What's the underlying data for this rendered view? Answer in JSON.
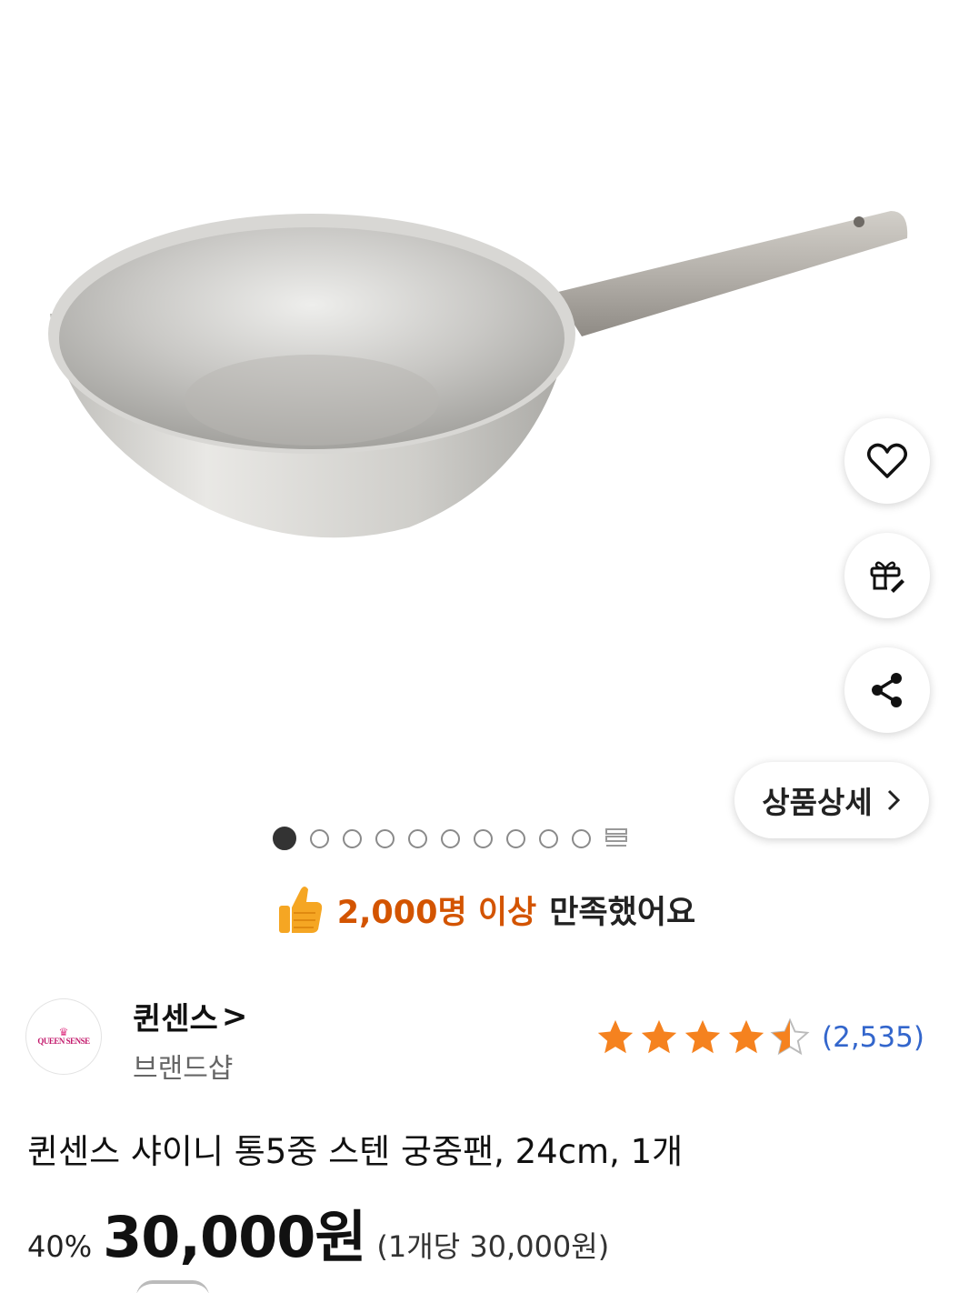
{
  "hero": {
    "image_alt": "stainless wok pan product photo"
  },
  "actions": {
    "wishlist_icon": "heart-icon",
    "gift_icon": "gift-icon",
    "share_icon": "share-icon"
  },
  "detail_button": {
    "label": "상품상세",
    "icon": "chevron-right-icon"
  },
  "carousel": {
    "total_dots": 10,
    "active_index": 0
  },
  "satisfaction": {
    "icon": "thumbs-up-icon",
    "highlight": "2,000명 이상",
    "text": "만족했어요"
  },
  "brand": {
    "logo_text": "QUEEN SENSE",
    "name": "퀸센스",
    "name_suffix": ">",
    "sub": "브랜드샵"
  },
  "rating": {
    "stars": 4.5,
    "review_count": "(2,535)",
    "star_color": "#f5821f"
  },
  "product": {
    "title": "퀸센스 샤이니 통5중 스텐 궁중팬, 24cm, 1개",
    "discount": "40%",
    "price": "30,000원",
    "unit_price": "(1개당 30,000원)"
  },
  "colors": {
    "accent": "#d35400",
    "link": "#3366cc"
  }
}
